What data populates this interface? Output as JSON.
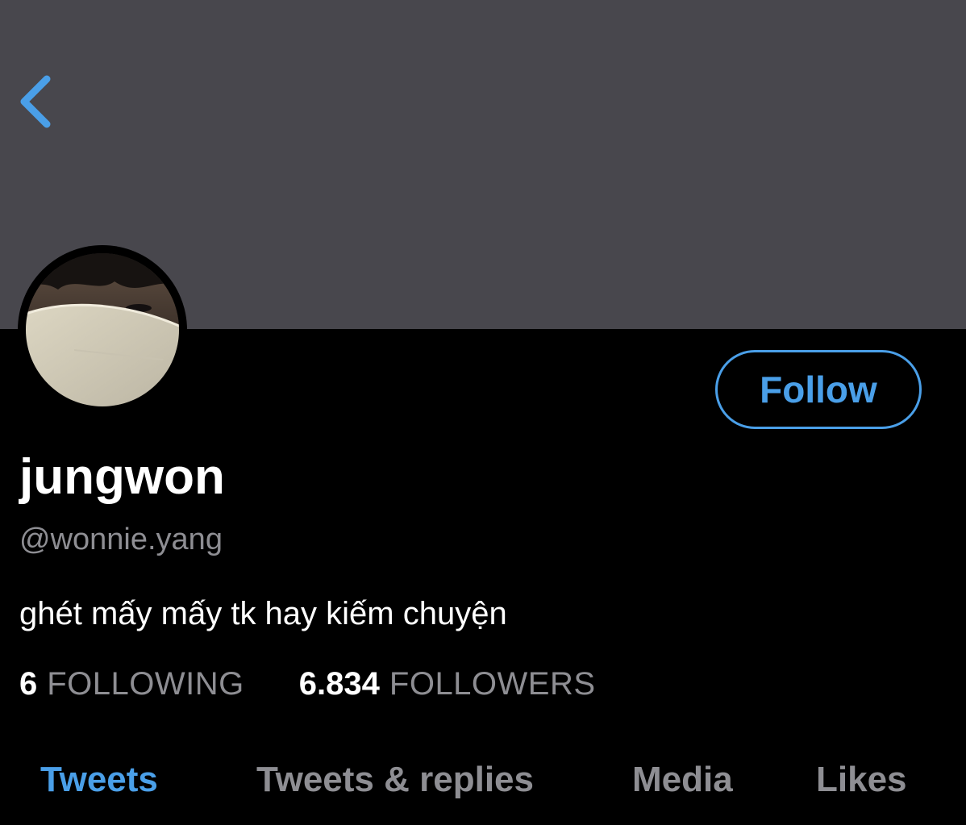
{
  "colors": {
    "banner": "#48474d",
    "background": "#000000",
    "accent": "#4a9fe8",
    "secondary_text": "#8e8e93",
    "primary_text": "#ffffff"
  },
  "header": {
    "back_icon": "chevron-left-icon"
  },
  "profile": {
    "follow_label": "Follow",
    "display_name": "jungwon",
    "handle": "@wonnie.yang",
    "bio": "ghét mấy mấy tk hay kiếm chuyện",
    "following_count": "6",
    "following_label": "FOLLOWING",
    "followers_count": "6.834",
    "followers_label": "FOLLOWERS"
  },
  "tabs": [
    {
      "label": "Tweets",
      "active": true
    },
    {
      "label": "Tweets & replies",
      "active": false
    },
    {
      "label": "Media",
      "active": false
    },
    {
      "label": "Likes",
      "active": false
    }
  ]
}
